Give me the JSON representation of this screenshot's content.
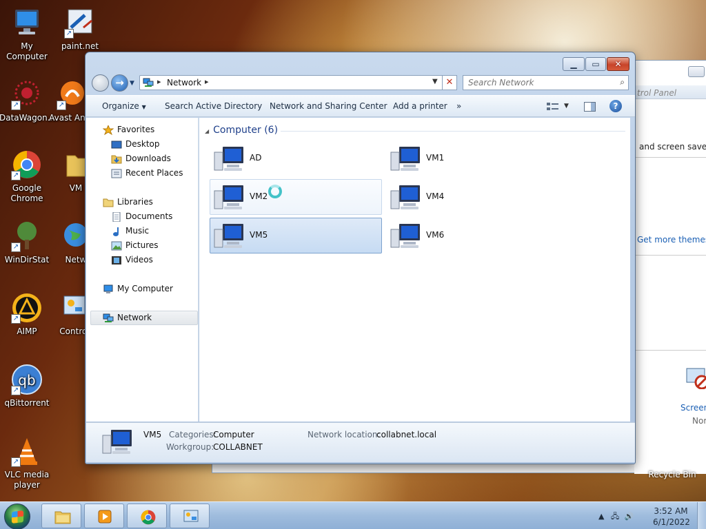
{
  "desktop": {
    "icons": [
      {
        "label": "My Computer"
      },
      {
        "label": "paint.net"
      },
      {
        "label": "DataWagon..."
      },
      {
        "label": "Avast Antiv"
      },
      {
        "label": "Google Chrome"
      },
      {
        "label": "VM"
      },
      {
        "label": "WinDirStat"
      },
      {
        "label": "Netw"
      },
      {
        "label": "AIMP"
      },
      {
        "label": "Control"
      },
      {
        "label": "qBittorrent"
      },
      {
        "label": "VLC media player"
      },
      {
        "label": "Recycle Bin"
      }
    ]
  },
  "back_window": {
    "address_fragment": "trol Panel",
    "line1": "and screen saver al",
    "link1": "Get more themes o",
    "screen_label": "Screen",
    "nor_label": "Nor"
  },
  "window": {
    "address": {
      "crumb": "Network"
    },
    "search": {
      "placeholder": "Search Network"
    },
    "toolbar": {
      "organize": "Organize",
      "search_ad": "Search Active Directory",
      "nsc": "Network and Sharing Center",
      "add_printer": "Add a printer",
      "more": "»"
    },
    "nav": {
      "favorites": "Favorites",
      "desktop": "Desktop",
      "downloads": "Downloads",
      "recent": "Recent Places",
      "libraries": "Libraries",
      "documents": "Documents",
      "music": "Music",
      "pictures": "Pictures",
      "videos": "Videos",
      "mycomputer": "My Computer",
      "network": "Network"
    },
    "group": {
      "title": "Computer (6)"
    },
    "computers": [
      "AD",
      "VM1",
      "VM2",
      "VM4",
      "VM5",
      "VM6"
    ],
    "details": {
      "name": "VM5",
      "categories_label": "Categories:",
      "categories_value": "Computer",
      "workgroup_label": "Workgroup:",
      "workgroup_value": "COLLABNET",
      "location_label": "Network location:",
      "location_value": "collabnet.local"
    }
  },
  "taskbar": {
    "time": "3:52 AM",
    "date": "6/1/2022"
  },
  "colors": {
    "accent": "#1e3f8a",
    "selection": "#c6dbf3"
  }
}
